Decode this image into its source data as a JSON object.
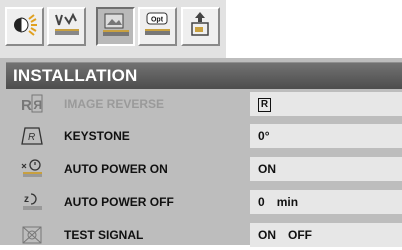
{
  "tabs": [
    {
      "icon": "brightness-icon",
      "active": false
    },
    {
      "icon": "video-settings-icon",
      "active": false
    },
    {
      "icon": "image-settings-icon",
      "active": true
    },
    {
      "icon": "option-icon",
      "label": "Opt",
      "active": false
    },
    {
      "icon": "installation-icon",
      "active": false
    }
  ],
  "header": {
    "title": "INSTALLATION"
  },
  "menu": [
    {
      "icon": "image-reverse-icon",
      "label": "IMAGE REVERSE",
      "value_glyph": "R",
      "enabled": false
    },
    {
      "icon": "keystone-icon",
      "label": "KEYSTONE",
      "value": "0",
      "unit": "°"
    },
    {
      "icon": "auto-power-on-icon",
      "label": "AUTO POWER ON",
      "value": "ON"
    },
    {
      "icon": "auto-power-off-icon",
      "label": "AUTO POWER OFF",
      "value": "0",
      "unit": "min"
    },
    {
      "icon": "test-signal-icon",
      "label": "TEST SIGNAL",
      "value": "ON",
      "value2": "OFF"
    }
  ]
}
